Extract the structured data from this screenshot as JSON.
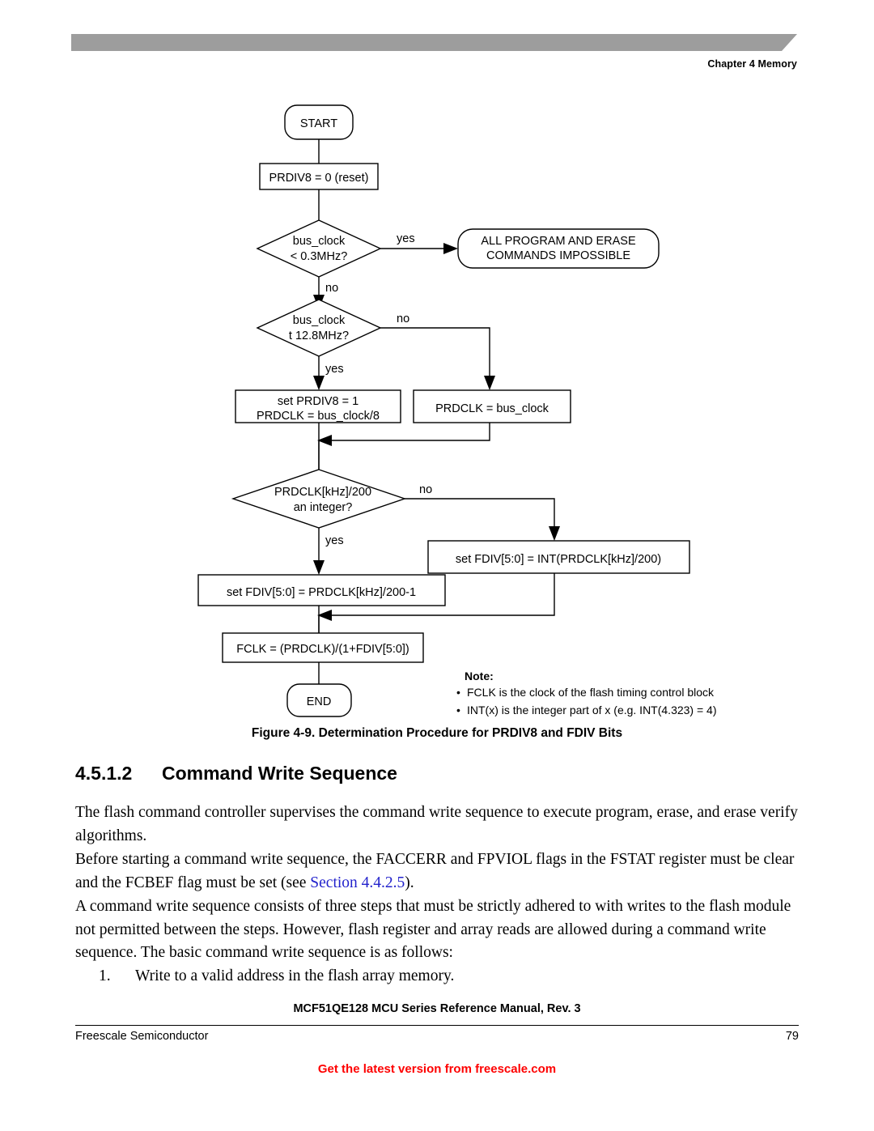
{
  "header": {
    "chapter_label": "Chapter 4 Memory",
    "bar_color": "#9d9d9d"
  },
  "figure": {
    "nodes": {
      "start": "START",
      "prdiv8_reset": "PRDIV8 = 0 (reset)",
      "decision1_line1": "bus_clock",
      "decision1_line2": "< 0.3MHz?",
      "impossible_line1": "ALL PROGRAM AND ERASE",
      "impossible_line2": "COMMANDS IMPOSSIBLE",
      "decision2_line1": "bus_clock",
      "decision2_line2": "t 12.8MHz?",
      "set_prdiv8_line1": "set PRDIV8 = 1",
      "set_prdiv8_line2": "PRDCLK = bus_clock/8",
      "prdclk_busclock": "PRDCLK = bus_clock",
      "decision3_line1": "PRDCLK[kHz]/200",
      "decision3_line2": "an integer?",
      "set_fdiv_int": "set FDIV[5:0] = INT(PRDCLK[kHz]/200)",
      "set_fdiv_minus1": "set FDIV[5:0] = PRDCLK[kHz]/200-1",
      "fclk": "FCLK = (PRDCLK)/(1+FDIV[5:0])",
      "end": "END"
    },
    "edge_labels": {
      "yes1": "yes",
      "no1": "no",
      "no2": "no",
      "yes2": "yes",
      "no3": "no",
      "yes3": "yes"
    },
    "note": {
      "heading": "Note:",
      "bullet_glyph": "•",
      "items": [
        "FCLK is the clock of the flash timing control block",
        "INT(x) is the integer part of x (e.g. INT(4.323) = 4)"
      ]
    },
    "caption": "Figure 4-9. Determination Procedure for PRDIV8 and FDIV Bits"
  },
  "section": {
    "number": "4.5.1.2",
    "title": "Command Write Sequence"
  },
  "body": {
    "para1": "The flash command controller supervises the command write sequence to execute program, erase, and erase verify algorithms.",
    "para2_before": "Before starting a command write sequence, the FACCERR and FPVIOL flags in the FSTAT register must be clear and the FCBEF flag must be set (see ",
    "para2_link": "Section 4.4.2.5",
    "para2_after": ").",
    "para3": "A command write sequence consists of three steps that must be strictly adhered to with writes to the flash module not permitted between the steps. However, flash register and array reads are allowed during a command write sequence. The basic command write sequence is as follows:",
    "list_marker": "1.",
    "list_item1": "Write to a valid address in the flash array memory."
  },
  "footer": {
    "title": "MCF51QE128 MCU Series Reference Manual, Rev. 3",
    "left": "Freescale Semiconductor",
    "page_number": "79",
    "link_text": "Get the latest version from freescale.com",
    "link_color": "#fe0000"
  }
}
